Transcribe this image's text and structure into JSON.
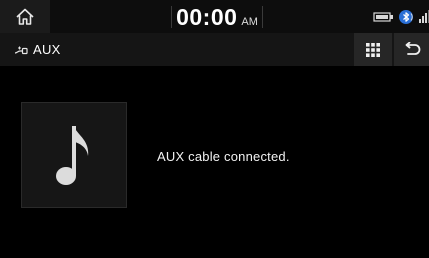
{
  "status_bar": {
    "time": "00:00",
    "ampm": "AM",
    "icons": [
      "home-icon",
      "battery-icon",
      "bluetooth-icon",
      "signal-icon"
    ]
  },
  "title_bar": {
    "title": "AUX",
    "title_icon": "aux-cable-icon",
    "menu_icon": "grid-menu-icon",
    "back_icon": "back-arrow-icon"
  },
  "main": {
    "album_art_icon": "music-note-icon",
    "message": "AUX cable connected."
  }
}
